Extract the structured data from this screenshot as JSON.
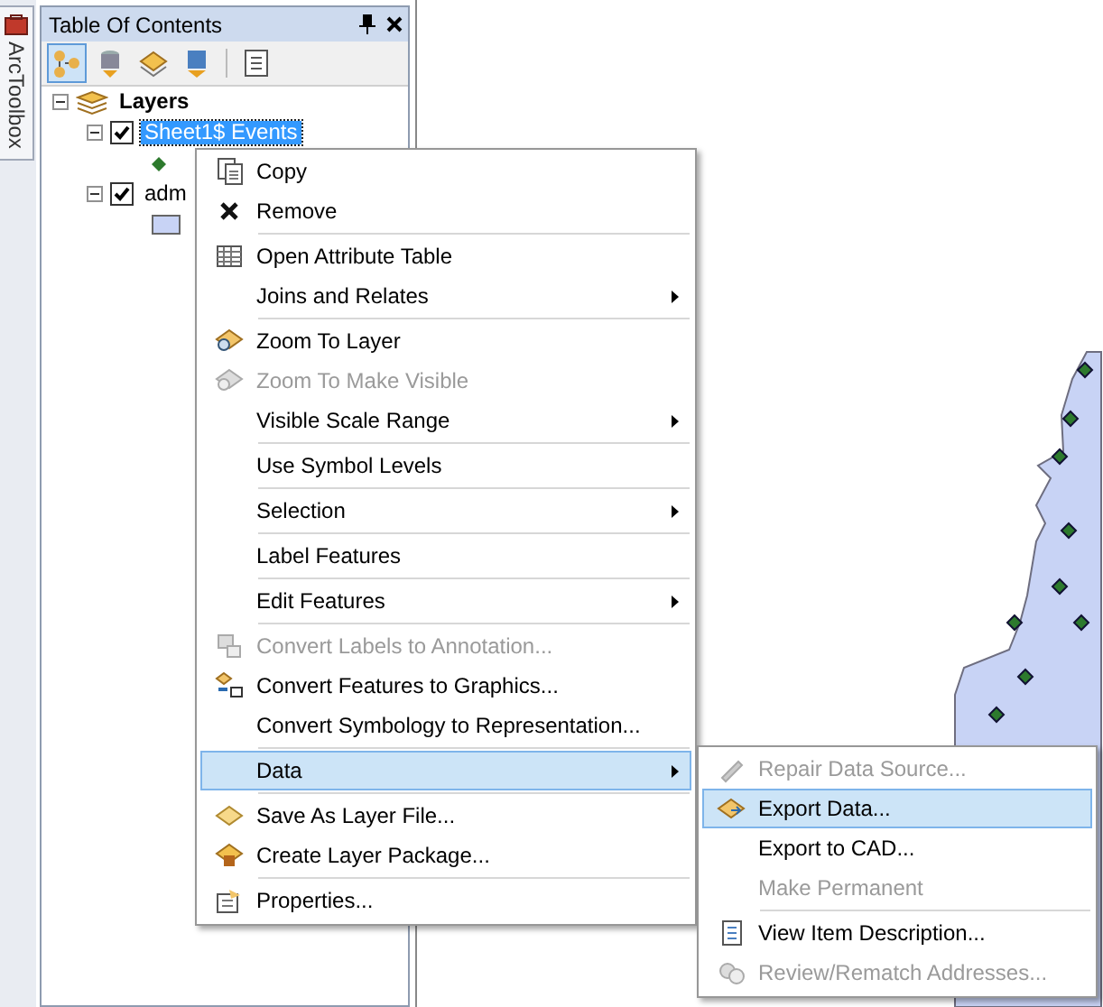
{
  "toolbox_tab": {
    "label": "ArcToolbox"
  },
  "toc": {
    "title": "Table Of Contents",
    "toolbar": [
      {
        "selected": true
      },
      {
        "selected": false
      },
      {
        "selected": false
      },
      {
        "selected": false
      },
      {
        "selected": false
      }
    ],
    "tree": [
      {
        "label": "Layers",
        "expanded": true,
        "children": [
          {
            "label": "Sheet1$ Events",
            "checked": true,
            "expanded": true,
            "selected": true,
            "legend": {
              "kind": "point"
            }
          },
          {
            "label": "adm",
            "checked": true,
            "expanded": true,
            "selected": false,
            "legend": {
              "kind": "polygon"
            }
          }
        ]
      }
    ]
  },
  "context_menu": {
    "items": [
      {
        "label": "Copy",
        "disabled": false,
        "submenu": false,
        "selected": false,
        "separator_before": false
      },
      {
        "label": "Remove",
        "disabled": false,
        "submenu": false,
        "selected": false,
        "separator_before": false
      },
      {
        "label": "Open Attribute Table",
        "disabled": false,
        "submenu": false,
        "selected": false,
        "separator_before": true
      },
      {
        "label": "Joins and Relates",
        "disabled": false,
        "submenu": true,
        "selected": false,
        "separator_before": false
      },
      {
        "label": "Zoom To Layer",
        "disabled": false,
        "submenu": false,
        "selected": false,
        "separator_before": true
      },
      {
        "label": "Zoom To Make Visible",
        "disabled": true,
        "submenu": false,
        "selected": false,
        "separator_before": false
      },
      {
        "label": "Visible Scale Range",
        "disabled": false,
        "submenu": true,
        "selected": false,
        "separator_before": false
      },
      {
        "label": "Use Symbol Levels",
        "disabled": false,
        "submenu": false,
        "selected": false,
        "separator_before": true
      },
      {
        "label": "Selection",
        "disabled": false,
        "submenu": true,
        "selected": false,
        "separator_before": true
      },
      {
        "label": "Label Features",
        "disabled": false,
        "submenu": false,
        "selected": false,
        "separator_before": true
      },
      {
        "label": "Edit Features",
        "disabled": false,
        "submenu": true,
        "selected": false,
        "separator_before": true
      },
      {
        "label": "Convert Labels to Annotation...",
        "disabled": true,
        "submenu": false,
        "selected": false,
        "separator_before": true
      },
      {
        "label": "Convert Features to Graphics...",
        "disabled": false,
        "submenu": false,
        "selected": false,
        "separator_before": false
      },
      {
        "label": "Convert Symbology to Representation...",
        "disabled": false,
        "submenu": false,
        "selected": false,
        "separator_before": false
      },
      {
        "label": "Data",
        "disabled": false,
        "submenu": true,
        "selected": true,
        "separator_before": true
      },
      {
        "label": "Save As Layer File...",
        "disabled": false,
        "submenu": false,
        "selected": false,
        "separator_before": true
      },
      {
        "label": "Create Layer Package...",
        "disabled": false,
        "submenu": false,
        "selected": false,
        "separator_before": false
      },
      {
        "label": "Properties...",
        "disabled": false,
        "submenu": false,
        "selected": false,
        "separator_before": true
      }
    ]
  },
  "submenu": {
    "items": [
      {
        "label": "Repair Data Source...",
        "disabled": true,
        "submenu": false,
        "selected": false,
        "separator_before": false
      },
      {
        "label": "Export Data...",
        "disabled": false,
        "submenu": false,
        "selected": true,
        "separator_before": false
      },
      {
        "label": "Export to CAD...",
        "disabled": false,
        "submenu": false,
        "selected": false,
        "separator_before": false
      },
      {
        "label": "Make Permanent",
        "disabled": true,
        "submenu": false,
        "selected": false,
        "separator_before": false
      },
      {
        "label": "View Item Description...",
        "disabled": false,
        "submenu": false,
        "selected": false,
        "separator_before": true
      },
      {
        "label": "Review/Rematch Addresses...",
        "disabled": true,
        "submenu": false,
        "selected": false,
        "separator_before": false
      }
    ]
  }
}
